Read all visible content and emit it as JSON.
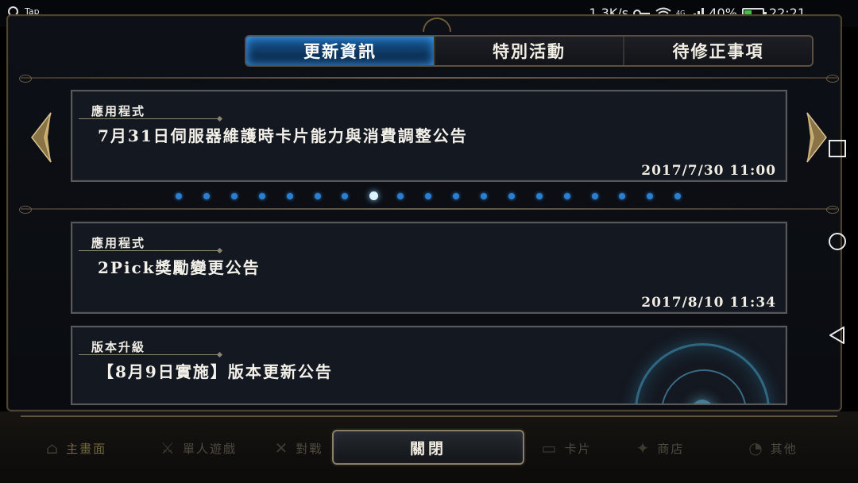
{
  "status_bar": {
    "app_label": "Tap",
    "net_speed": "1.3K/s",
    "signal_label": "4G",
    "battery": "40%",
    "battery_level": 0.4,
    "time": "22:21"
  },
  "tabs": [
    {
      "label": "更新資訊",
      "active": true
    },
    {
      "label": "特別活動",
      "active": false
    },
    {
      "label": "待修正事項",
      "active": false
    }
  ],
  "featured": {
    "category": "應用程式",
    "title": "7月31日伺服器維護時卡片能力與消費調整公告",
    "date": "2017/7/30 11:00"
  },
  "pagination": {
    "count": 19,
    "active_index": 7
  },
  "news": [
    {
      "category": "應用程式",
      "title": "2Pick獎勵變更公告",
      "date": "2017/8/10 11:34"
    },
    {
      "category": "版本升級",
      "title": "【8月9日實施】版本更新公告",
      "date": ""
    }
  ],
  "bottom_menu": [
    {
      "label": "主畫面",
      "icon": "home-icon"
    },
    {
      "label": "單人遊戲",
      "icon": "sword-icon"
    },
    {
      "label": "對戰",
      "icon": "crossed-swords-icon"
    },
    {
      "label": "卡片",
      "icon": "cards-icon"
    },
    {
      "label": "商店",
      "icon": "shop-icon"
    },
    {
      "label": "其他",
      "icon": "more-icon"
    }
  ],
  "close_label": "關閉",
  "colors": {
    "tab_active": "#1a5d9c",
    "dot": "#2b7fd0",
    "gold": "#8a7e66"
  }
}
